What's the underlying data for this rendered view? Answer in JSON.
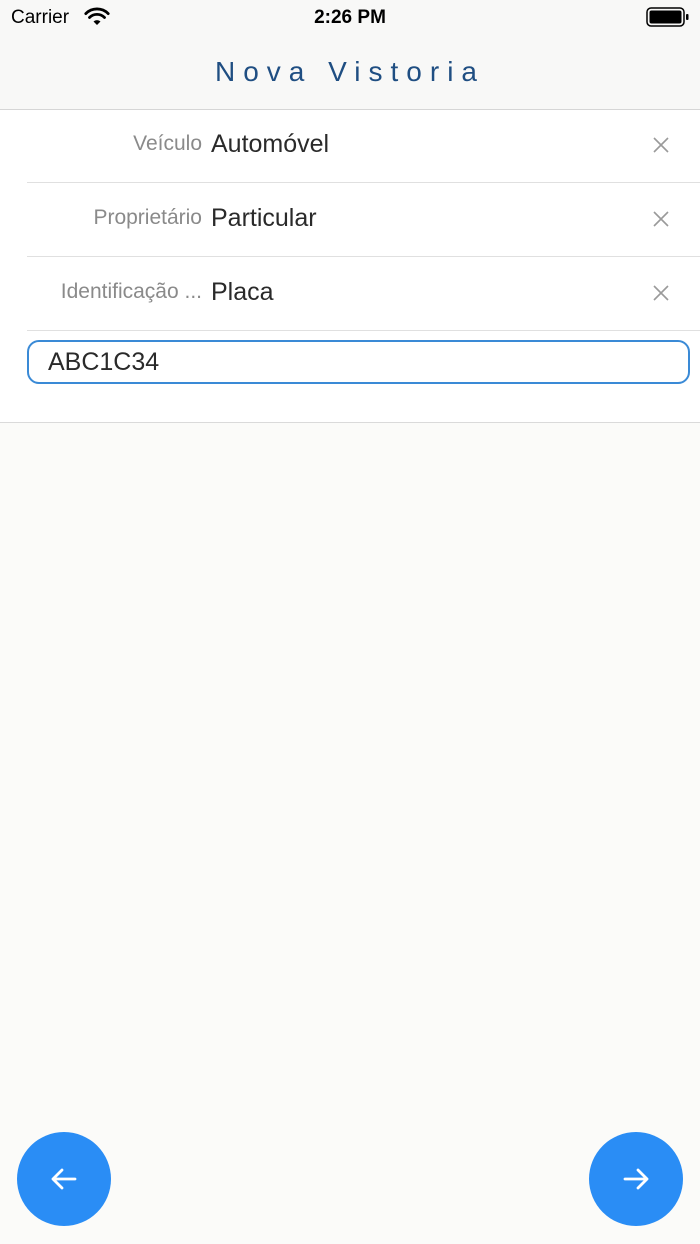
{
  "status_bar": {
    "carrier": "Carrier",
    "time": "2:26 PM"
  },
  "header": {
    "title": "Nova Vistoria"
  },
  "form": {
    "rows": [
      {
        "label": "Veículo",
        "value": "Automóvel"
      },
      {
        "label": "Proprietário",
        "value": "Particular"
      },
      {
        "label": "Identificação ...",
        "value": "Placa"
      }
    ],
    "plate_input": {
      "value": "ABC1C34"
    }
  },
  "icons": {
    "wifi": "wifi-icon",
    "battery": "battery-icon",
    "clear": "close-icon",
    "back": "arrow-left-icon",
    "next": "arrow-right-icon"
  },
  "colors": {
    "accent": "#2a8df5",
    "title": "#1f4e82",
    "input_border": "#3a8ad6"
  }
}
